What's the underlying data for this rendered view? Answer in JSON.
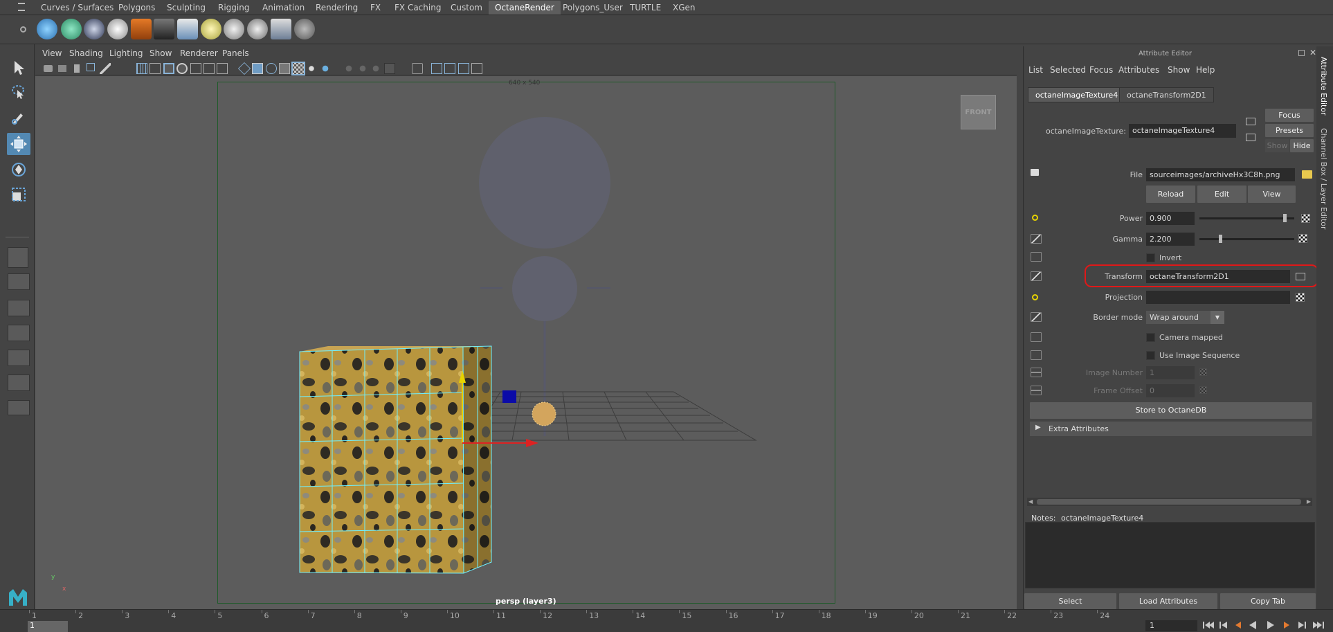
{
  "shelf": {
    "tabs": [
      "Curves / Surfaces",
      "Polygons",
      "Sculpting",
      "Rigging",
      "Animation",
      "Rendering",
      "FX",
      "FX Caching",
      "Custom",
      "OctaneRender",
      "Polygons_User",
      "TURTLE",
      "XGen"
    ],
    "active_tab": "OctaneRender"
  },
  "viewport": {
    "menu": [
      "View",
      "Shading",
      "Lighting",
      "Show",
      "Renderer",
      "Panels"
    ],
    "resolution_label": "640 x 540",
    "camera_label": "persp (layer3)",
    "view_cube_label": "FRONT",
    "axis_x": "x",
    "axis_y": "y"
  },
  "timeline": {
    "ticks": [
      "1",
      "2",
      "3",
      "4",
      "5",
      "6",
      "7",
      "8",
      "9",
      "10",
      "11",
      "12",
      "13",
      "14",
      "15",
      "16",
      "17",
      "18",
      "19",
      "20",
      "21",
      "22",
      "23",
      "24"
    ],
    "start_frame": "1",
    "current_frame": "1"
  },
  "attribute_editor": {
    "title": "Attribute Editor",
    "menu": [
      "List",
      "Selected",
      "Focus",
      "Attributes",
      "Show",
      "Help"
    ],
    "tabs": [
      "octaneImageTexture4",
      "octaneTransform2D1"
    ],
    "node_label": "octaneImageTexture:",
    "node_name": "octaneImageTexture4",
    "focus_label": "Focus",
    "presets_label": "Presets",
    "show_label": "Show",
    "hide_label": "Hide",
    "file_label": "File",
    "file_value": "sourceimages/archiveHx3C8h.png",
    "reload_label": "Reload",
    "edit_label": "Edit",
    "view_label": "View",
    "power_label": "Power",
    "power_value": "0.900",
    "power_fraction": 0.9,
    "gamma_label": "Gamma",
    "gamma_value": "2.200",
    "gamma_fraction": 0.22,
    "invert_label": "Invert",
    "transform_label": "Transform",
    "transform_value": "octaneTransform2D1",
    "projection_label": "Projection",
    "projection_value": "",
    "border_mode_label": "Border mode",
    "border_mode_value": "Wrap around",
    "camera_mapped_label": "Camera mapped",
    "use_image_sequence_label": "Use Image Sequence",
    "image_number_label": "Image Number",
    "image_number_value": "1",
    "frame_offset_label": "Frame Offset",
    "frame_offset_value": "0",
    "store_label": "Store to OctaneDB",
    "extra_attributes_label": "Extra Attributes",
    "notes_label": "Notes:",
    "notes_node": "octaneImageTexture4",
    "bottom_buttons": [
      "Select",
      "Load Attributes",
      "Copy Tab"
    ],
    "side_tabs": [
      "Attribute Editor",
      "Channel Box / Layer Editor"
    ]
  }
}
